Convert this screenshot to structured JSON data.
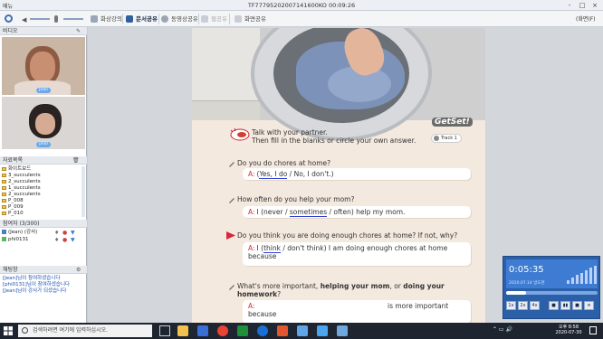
{
  "window": {
    "menu_label": "메뉴",
    "session_title": "TF77795202007141600KO 00:09:26",
    "controls": [
      "-",
      "□",
      "×"
    ]
  },
  "toolbar": {
    "tabs": [
      {
        "label": "화상강의",
        "state": "normal"
      },
      {
        "label": "문서공유",
        "state": "active"
      },
      {
        "label": "동영상공유",
        "state": "normal"
      },
      {
        "label": "웹공유",
        "state": "disabled"
      },
      {
        "label": "화면공유",
        "state": "normal"
      }
    ],
    "fullscreen_label": "(화면(F)"
  },
  "left_panel": {
    "video_header": "비디오",
    "video_tiles": [
      {
        "name": "Jean"
      },
      {
        "name": "phi0"
      }
    ],
    "resources_header": "자료목록",
    "resources": [
      "화이트보드",
      "3_succulents",
      "2_succulents",
      "1_succulents",
      "2_succulents",
      "P_008",
      "P_009",
      "P_010"
    ],
    "participants_header": "참여자 (3/300)",
    "participants": [
      {
        "name": "(Jean) (강사)"
      },
      {
        "name": "phi0131"
      }
    ],
    "chat_header": "채팅창",
    "chat_messages": [
      "[Jean]님이 참여하셨습니다",
      "[phi0131]님이 참여하셨습니다",
      "[Jean]님이 강사가 되셨습니다"
    ]
  },
  "page": {
    "logo": "GetSet!",
    "instruction_line1": "Talk with your partner.",
    "instruction_line2": "Then fill in the blanks or circle your own answer.",
    "track_label": "Track 1",
    "items": [
      {
        "question": "Do you do chores at home?",
        "answer_prefix": "A:",
        "answer_parts": [
          "(",
          "Yes, I do",
          " / No, I don't.)"
        ]
      },
      {
        "question": "How often do you help your mom?",
        "answer_prefix": "A:",
        "answer_parts": [
          "I (never / ",
          "sometimes",
          " / often) help my mom."
        ]
      },
      {
        "question": "Do you think you are doing enough chores at home? If not, why?",
        "answer_prefix": "A:",
        "answer_parts": [
          "I (",
          "think",
          " / don't think) I am doing enough chores at home"
        ],
        "answer_line2": "because"
      },
      {
        "question_parts": [
          "What's more important, ",
          "helping your mom",
          ", or ",
          "doing your",
          "homework",
          "?"
        ],
        "answer_prefix": "A:",
        "answer_right": "is more important",
        "answer_line2": "because"
      }
    ]
  },
  "player": {
    "time": "0:05:35",
    "date_text": "2020.07.14 방도현",
    "progress": 0.22,
    "buttons": [
      "1x",
      "2x",
      "4x",
      "■",
      "▮▮",
      "■",
      "≡"
    ]
  },
  "taskbar": {
    "search_placeholder": "검색하려면 여기에 입력하십시오.",
    "time": "오후 8:58",
    "date": "2020-07-30"
  },
  "colors": {
    "answer_marker": "#d6293a",
    "pen_ink": "#2d3fd0",
    "player_bg": "#2b5fa8"
  }
}
